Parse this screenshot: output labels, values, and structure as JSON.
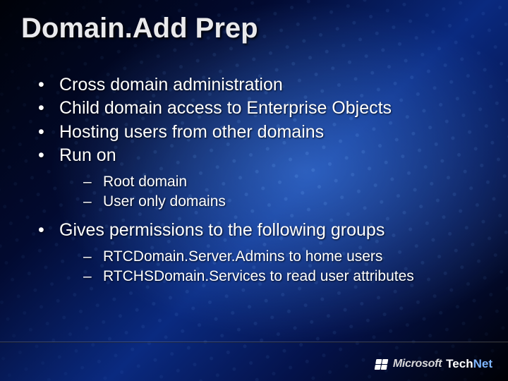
{
  "title": "Domain.Add Prep",
  "bullets": [
    {
      "text": "Cross domain administration"
    },
    {
      "text": "Child domain access to Enterprise Objects"
    },
    {
      "text": "Hosting users from other domains"
    },
    {
      "text": "Run on",
      "children": [
        {
          "text": "Root domain"
        },
        {
          "text": "User only domains"
        }
      ]
    },
    {
      "text": "Gives permissions to the following groups",
      "children": [
        {
          "text": "RTCDomain.Server.Admins to home users"
        },
        {
          "text": "RTCHSDomain.Services to read user attributes"
        }
      ]
    }
  ],
  "footer": {
    "brand": "Microsoft",
    "product_a": "Tech",
    "product_b": "Net"
  }
}
